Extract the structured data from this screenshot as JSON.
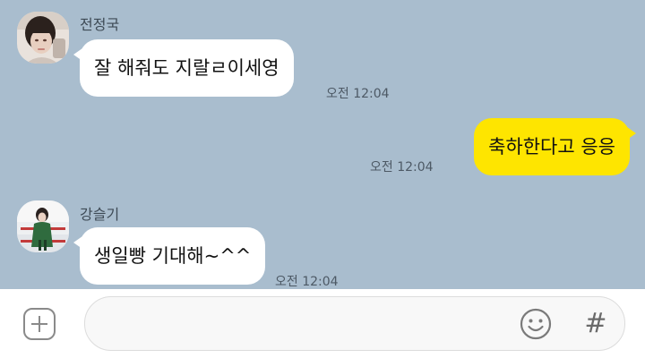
{
  "messages": [
    {
      "sender": "전정국",
      "text": "잘 해줘도 지랄ㄹ이세영",
      "time": "오전 12:04",
      "direction": "incoming"
    },
    {
      "text": "축하한다고 응응",
      "time": "오전 12:04",
      "direction": "outgoing"
    },
    {
      "sender": "강슬기",
      "text": "생일빵 기대해~^^",
      "time": "오전 12:04",
      "direction": "incoming"
    }
  ],
  "composer": {
    "add_icon": "plus-square-icon",
    "emoji_icon": "smiley-icon",
    "hash_label": "#"
  },
  "colors": {
    "chat_background": "#a9bdce",
    "incoming_bubble": "#ffffff",
    "outgoing_bubble": "#fee500",
    "input_bar": "#ffffff"
  }
}
